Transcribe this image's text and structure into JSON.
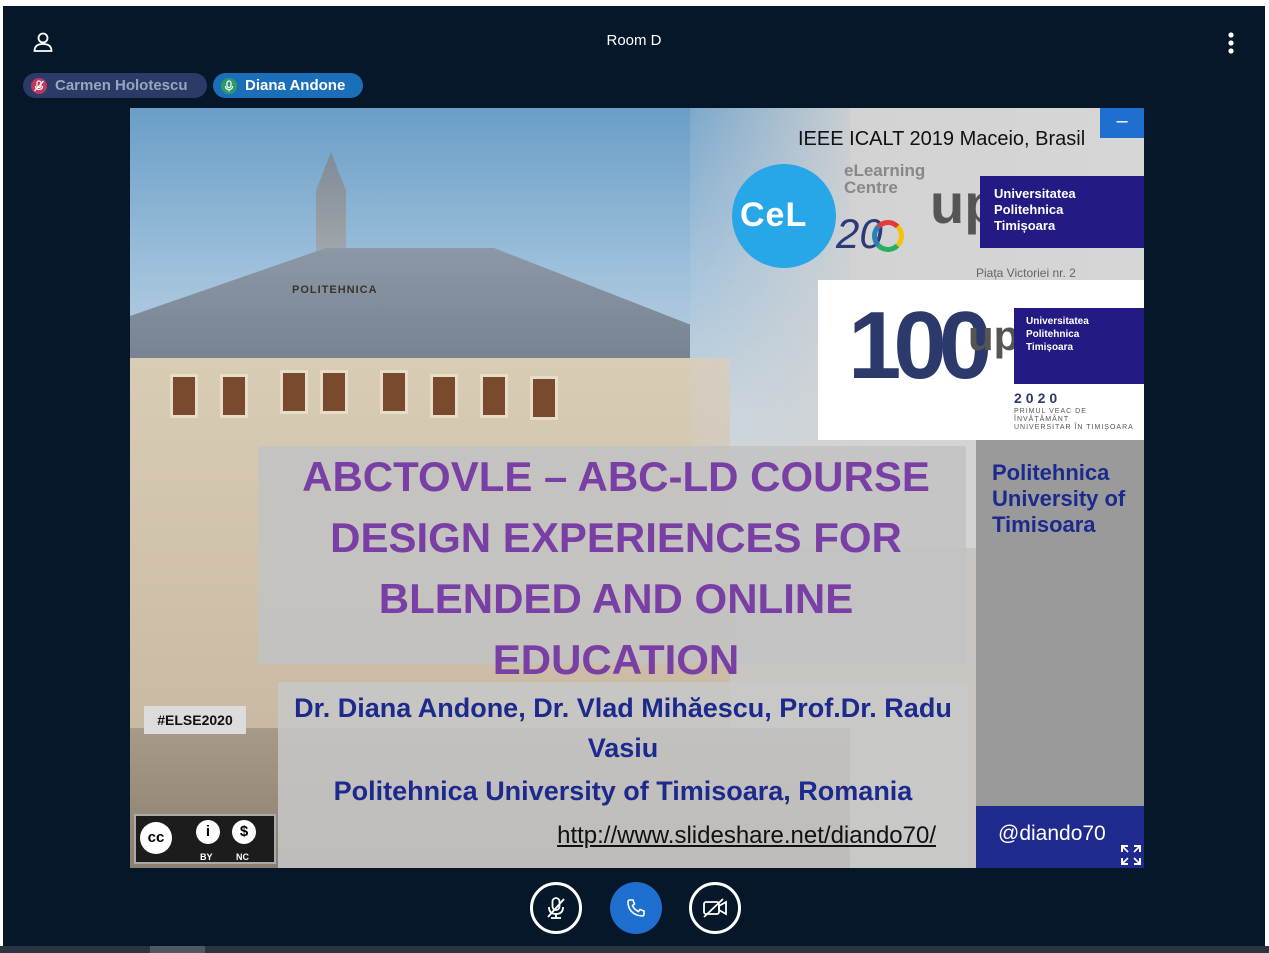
{
  "header": {
    "room_title": "Room D"
  },
  "participants": [
    {
      "name": "Carmen Holotescu",
      "muted": true,
      "color": "#c0395e"
    },
    {
      "name": "Diana Andone",
      "muted": false,
      "color": "#2e9c6a"
    }
  ],
  "slide": {
    "conference": "IEEE ICALT 2019 Maceio, Brasil",
    "minimize_label": "–",
    "elearning": [
      "eLearning",
      "Centre"
    ],
    "cel_logo": "CeL",
    "twenty": "20",
    "upt_mark": "up",
    "upt_lines": [
      "Universitatea",
      "Politehnica",
      "Timișoara"
    ],
    "piata": "Piața Victoriei nr. 2",
    "centenary": "100",
    "centenary_year": "2020",
    "centenary_caption": [
      "PRIMUL VEAC DE ÎNVĂȚĂMÂNT",
      "UNIVERSITAR ÎN TIMIȘOARA"
    ],
    "building_label": "POLITEHNICA",
    "side_title": [
      "Politehnica",
      "University of",
      "Timisoara"
    ],
    "title": "ABCTOVLE – ABC-LD COURSE DESIGN EXPERIENCES FOR BLENDED AND ONLINE EDUCATION",
    "authors": "Dr. Diana Andone, Dr. Vlad Mihăescu, Prof.Dr. Radu Vasiu",
    "affiliation": "Politehnica University of Timisoara, Romania",
    "url": "http://www.slideshare.net/diando70/",
    "handle": "@diando70",
    "hashtag": "#ELSE2020",
    "license": {
      "cc": "cc",
      "by": "BY",
      "nc": "NC"
    }
  },
  "controls": {
    "mute": "microphone-off",
    "call": "phone",
    "camera": "camera-off"
  },
  "colors": {
    "background": "#06172a",
    "accent": "#1f6fd1",
    "title": "#7a3fa4",
    "navy": "#1b2a8c"
  }
}
